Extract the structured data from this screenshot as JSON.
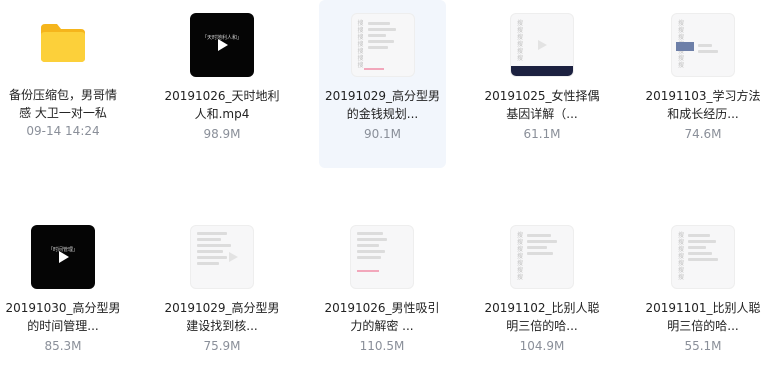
{
  "files": [
    {
      "name": "备份压缩包，男哥情感 大卫一对一私",
      "meta": "09-14 14:24",
      "thumb": "folder"
    },
    {
      "name": "20191026_天时地利人和.mp4",
      "meta": "98.9M",
      "thumb": "black",
      "thumb_caption": "「天时地利人和」"
    },
    {
      "name": "20191029_高分型男的金钱规划...",
      "meta": "90.1M",
      "thumb": "doc"
    },
    {
      "name": "20191025_女性择偶基因详解（...",
      "meta": "61.1M",
      "thumb": "doc-dark"
    },
    {
      "name": "20191103_学习方法和成长经历...",
      "meta": "74.6M",
      "thumb": "doc-img"
    },
    {
      "name": "20191030_高分型男的时间管理...",
      "meta": "85.3M",
      "thumb": "black",
      "thumb_caption": "「时间管理」"
    },
    {
      "name": "20191029_高分型男建设找到核...",
      "meta": "75.9M",
      "thumb": "doc"
    },
    {
      "name": "20191026_男性吸引力的解密 ...",
      "meta": "110.5M",
      "thumb": "doc"
    },
    {
      "name": "20191102_比别人聪明三倍的哈...",
      "meta": "104.9M",
      "thumb": "doc"
    },
    {
      "name": "20191101_比别人聪明三倍的哈...",
      "meta": "55.1M",
      "thumb": "doc"
    }
  ],
  "colors": {
    "folder": "#f9c22e",
    "selected_bg": "#f2f6fc",
    "meta_text": "#8a8f99"
  }
}
